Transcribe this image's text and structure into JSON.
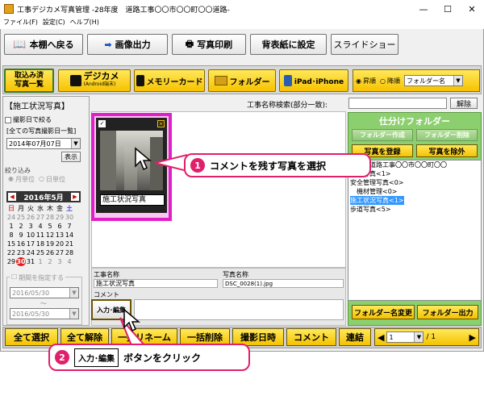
{
  "window": {
    "title": "工事デジカメ写真管理 -28年度　道路工事〇〇市〇〇町〇〇道路-",
    "minimize": "—",
    "maximize": "☐",
    "close": "✕"
  },
  "menu": [
    "ファイル(F)",
    "設定(C)",
    "ヘルプ(H)"
  ],
  "toolbar": {
    "back": "本棚へ戻る",
    "export_image": "画像出力",
    "print_photo": "写真印刷",
    "cover_setting": "背表紙に設定",
    "slideshow": "スライドショー"
  },
  "sources": {
    "imported_list": "取込み済\n写真一覧",
    "digicam": "デジカメ",
    "digicam_sub": "(Android端末)",
    "memory_card": "メモリーカード",
    "folder": "フォルダー",
    "ipad": "iPad･iPhone",
    "sort_asc": "昇順",
    "sort_desc": "降順",
    "sort_field": "フォルダー名"
  },
  "left": {
    "section_title": "【施工状況写真】",
    "filter_by_date": "撮影日で絞る",
    "date_scope": "[全ての写真撮影日一覧]",
    "date_value": "2014年07月07日",
    "show_button": "表示",
    "narrow_label": "絞り込み",
    "by_month": "月単位",
    "by_day": "日単位",
    "calendar_title": "2016年5月",
    "weekdays": [
      "日",
      "月",
      "火",
      "水",
      "木",
      "金",
      "土"
    ],
    "weeks": [
      [
        "24",
        "25",
        "26",
        "27",
        "28",
        "29",
        "30"
      ],
      [
        "1",
        "2",
        "3",
        "4",
        "5",
        "6",
        "7"
      ],
      [
        "8",
        "9",
        "10",
        "11",
        "12",
        "13",
        "14"
      ],
      [
        "15",
        "16",
        "17",
        "18",
        "19",
        "20",
        "21"
      ],
      [
        "22",
        "23",
        "24",
        "25",
        "26",
        "27",
        "28"
      ],
      [
        "29",
        "30",
        "31",
        "1",
        "2",
        "3",
        "4"
      ]
    ],
    "range_label": "期間を指定する",
    "range_from": "2016/05/30",
    "range_tilde": "〜",
    "range_to": "2016/05/30"
  },
  "search": {
    "label": "工事名称検索(部分一致):",
    "clear_button": "解除"
  },
  "photo": {
    "caption": "施工状況写真"
  },
  "details": {
    "project_label": "工事名称",
    "project_value": "施工状況写真",
    "photo_label": "写真名称",
    "photo_value": "DSC_0028(1).jpg",
    "comment_label": "コメント",
    "edit_button": "入力･編集"
  },
  "right": {
    "header": "仕分けフォルダー",
    "create_folder": "フォルダー作成",
    "delete_folder": "フォルダー削除",
    "register_photo": "写真を登録",
    "remove_photo": "写真を除外",
    "tree": [
      "年度　道路工事〇〇市〇〇町〇〇",
      "　料写真<1>",
      "安全管理写真<0>",
      "　機材管理<0>",
      "施工状況写真<1>",
      "歩道写真<5>"
    ],
    "rename_folder": "フォルダー名変更",
    "export_folder": "フォルダー出力"
  },
  "bottom": {
    "select_all": "全て選択",
    "deselect_all": "全て解除",
    "bulk_rename": "一括リネーム",
    "bulk_delete": "一括削除",
    "shoot_date": "撮影日時",
    "comment": "コメント",
    "join": "連結",
    "page_current": "1",
    "page_total": "/ 1"
  },
  "callouts": {
    "step1_num": "1",
    "step1_text": "コメントを残す写真を選択",
    "step2_num": "2",
    "step2_button": "入力･編集",
    "step2_text": "ボタンをクリック"
  },
  "colors": {
    "accent_yellow": "#f7c200",
    "highlight_magenta": "#e020c8",
    "callout_pink": "#e0206a",
    "folder_panel_green": "#8ccf6e",
    "selection_blue": "#3399ff"
  }
}
